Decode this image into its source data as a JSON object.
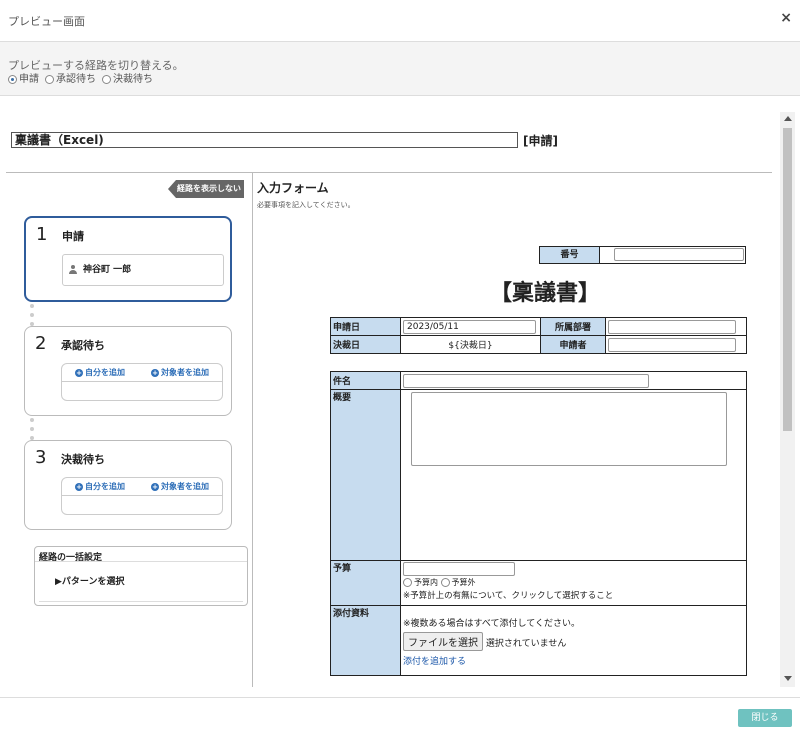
{
  "dialog": {
    "title": "プレビュー画面",
    "close_icon": "×"
  },
  "route_switch": {
    "label": "プレビューする経路を切り替える。",
    "options": [
      {
        "label": "申請",
        "selected": true
      },
      {
        "label": "承認待ち",
        "selected": false
      },
      {
        "label": "決裁待ち",
        "selected": false
      }
    ]
  },
  "document": {
    "title": "稟議書（Excel)",
    "status_tag": "[申請]"
  },
  "route": {
    "hide_label": "経路を表示しない",
    "steps": [
      {
        "number": "1",
        "name": "申請",
        "person": "神谷町 一郎"
      },
      {
        "number": "2",
        "name": "承認待ち",
        "add_self": "自分を追加",
        "add_target": "対象者を追加"
      },
      {
        "number": "3",
        "name": "決裁待ち",
        "add_self": "自分を追加",
        "add_target": "対象者を追加"
      }
    ],
    "bulk": {
      "heading": "経路の一括設定",
      "pick_pattern": "▶パターンを選択"
    }
  },
  "form": {
    "heading": "入力フォーム",
    "note": "必要事項を記入してください。",
    "number_label": "番号",
    "doc_title": "【稟議書】",
    "apply_date_label": "申請日",
    "apply_date_value": "2023/05/11",
    "dept_label": "所属部署",
    "decide_date_label": "決裁日",
    "decide_date_value": "${決裁日}",
    "applicant_label": "申請者",
    "subject_label": "件名",
    "summary_label": "概要",
    "budget_label": "予算",
    "budget_options": [
      "予算内",
      "予算外"
    ],
    "budget_note": "※予算計上の有無について、クリックして選択すること",
    "attach_label": "添付資料",
    "attach_note": "※複数ある場合はすべて添付してください。",
    "file_button": "ファイルを選択",
    "file_status": "選択されていません",
    "add_attach": "添付を追加する"
  },
  "footer": {
    "close_label": "閉じる"
  }
}
